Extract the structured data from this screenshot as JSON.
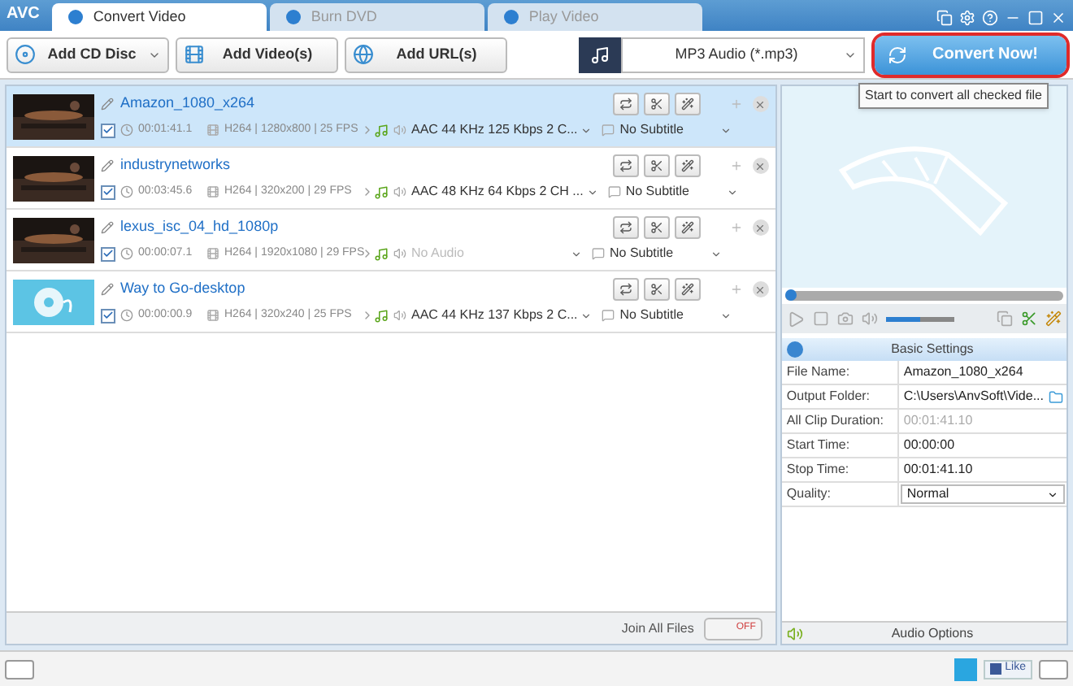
{
  "app_logo": "AVC",
  "tabs": [
    {
      "label": "Convert Video",
      "selected": true
    },
    {
      "label": "Burn DVD",
      "selected": false
    },
    {
      "label": "Play Video",
      "selected": false
    }
  ],
  "toolbar": {
    "buttons": [
      {
        "label": "Add CD Disc",
        "kind": "disc",
        "dropdown": true
      },
      {
        "label": "Add Video(s)",
        "kind": "video",
        "dropdown": false
      },
      {
        "label": "Add URL(s)",
        "kind": "url",
        "dropdown": false
      }
    ],
    "format": "MP3 Audio (*.mp3)",
    "convert_button": "Convert Now!",
    "tooltip": "Start to convert all checked file"
  },
  "files": [
    {
      "name": "Amazon_1080_x264",
      "selected": true,
      "checked": true,
      "duration": "00:01:41.1",
      "video_info": "H264 | 1280x800 | 25 FPS",
      "audio": "AAC 44 KHz 125 Kbps 2 C...",
      "has_audio": true,
      "subtitle": "No Subtitle"
    },
    {
      "name": "industrynetworks",
      "selected": false,
      "checked": true,
      "duration": "00:03:45.6",
      "video_info": "H264 | 320x200 | 29 FPS",
      "audio": "AAC 48 KHz 64 Kbps 2 CH ...",
      "has_audio": true,
      "subtitle": "No Subtitle"
    },
    {
      "name": "lexus_isc_04_hd_1080p",
      "selected": false,
      "checked": true,
      "duration": "00:00:07.1",
      "video_info": "H264 | 1920x1080 | 29 FPS",
      "audio": "No Audio",
      "has_audio": false,
      "subtitle": "No Subtitle"
    },
    {
      "name": "Way to Go-desktop",
      "selected": false,
      "checked": true,
      "duration": "00:00:00.9",
      "video_info": "H264 | 320x240 | 25 FPS",
      "audio": "AAC 44 KHz 137 Kbps 2 C...",
      "has_audio": true,
      "subtitle": "No Subtitle"
    }
  ],
  "join": {
    "label": "Join All Files",
    "toggle_label": "OFF",
    "on": false
  },
  "player": {
    "seek": {
      "level": 0
    },
    "volume": {
      "level": 0.5
    }
  },
  "basic_settings": {
    "title": "Basic Settings",
    "fields": [
      {
        "label": "File Name:",
        "value": "Amazon_1080_x264",
        "kind": "text"
      },
      {
        "label": "Output Folder:",
        "value": "C:\\Users\\AnvSoft\\Vide...",
        "kind": "folder"
      },
      {
        "label": "All Clip Duration:",
        "value": "00:01:41.10",
        "kind": "readonly"
      },
      {
        "label": "Start Time:",
        "value": "00:00:00",
        "kind": "text"
      },
      {
        "label": "Stop Time:",
        "value": "00:01:41.10",
        "kind": "text"
      },
      {
        "label": "Quality:",
        "value": "Normal",
        "kind": "select"
      }
    ]
  },
  "audio_options": {
    "title": "Audio Options"
  },
  "status_bar": {
    "like": "Like"
  }
}
